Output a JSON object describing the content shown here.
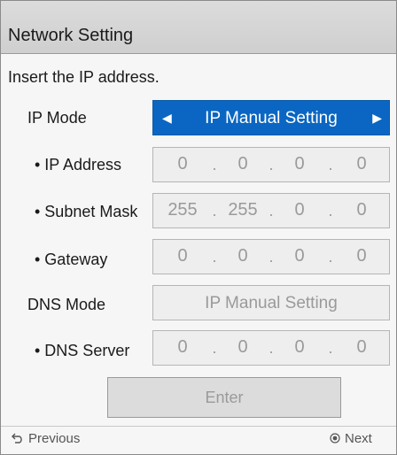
{
  "window": {
    "title": "Network Setting"
  },
  "instruction": "Insert the IP address.",
  "ip_mode": {
    "label": "IP Mode",
    "value": "IP Manual Setting"
  },
  "ip_address": {
    "label": "• IP Address",
    "octets": [
      "0",
      "0",
      "0",
      "0"
    ]
  },
  "subnet_mask": {
    "label": "• Subnet Mask",
    "octets": [
      "255",
      "255",
      "0",
      "0"
    ]
  },
  "gateway": {
    "label": "• Gateway",
    "octets": [
      "0",
      "0",
      "0",
      "0"
    ]
  },
  "dns_mode": {
    "label": "DNS Mode",
    "value": "IP Manual Setting"
  },
  "dns_server": {
    "label": "• DNS Server",
    "octets": [
      "0",
      "0",
      "0",
      "0"
    ]
  },
  "separator": ".",
  "enter_label": "Enter",
  "footer": {
    "previous_label": "Previous",
    "next_label": "Next"
  },
  "colors": {
    "accent": "#0a66c2",
    "title_bar": "#d6d6d6",
    "disabled_text": "#9a9a9a"
  }
}
